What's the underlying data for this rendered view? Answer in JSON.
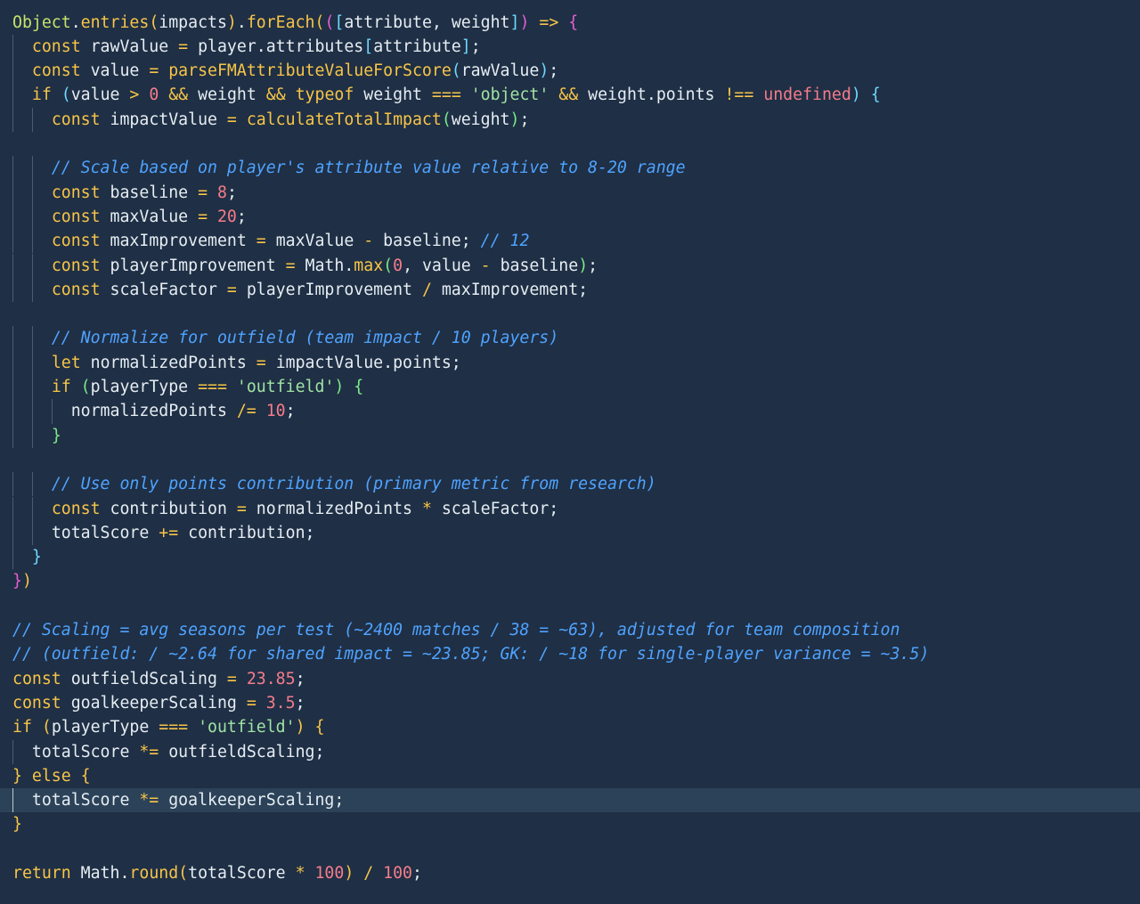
{
  "editor": {
    "language": "javascript",
    "colors": {
      "background": "#1f2f45",
      "current_line": "#2b4258",
      "keyword": "#f7c548",
      "text": "#e6edf3",
      "number": "#f47c8a",
      "string": "#9fe3a4",
      "comment": "#4fa3ff"
    },
    "lines": [
      "Object.entries(impacts).forEach(([attribute, weight]) => {",
      "  const rawValue = player.attributes[attribute];",
      "  const value = parseFMAttributeValueForScore(rawValue);",
      "  if (value > 0 && weight && typeof weight === 'object' && weight.points !== undefined) {",
      "    const impactValue = calculateTotalImpact(weight);",
      "",
      "    // Scale based on player's attribute value relative to 8-20 range",
      "    const baseline = 8;",
      "    const maxValue = 20;",
      "    const maxImprovement = maxValue - baseline; // 12",
      "    const playerImprovement = Math.max(0, value - baseline);",
      "    const scaleFactor = playerImprovement / maxImprovement;",
      "",
      "    // Normalize for outfield (team impact / 10 players)",
      "    let normalizedPoints = impactValue.points;",
      "    if (playerType === 'outfield') {",
      "      normalizedPoints /= 10;",
      "    }",
      "",
      "    // Use only points contribution (primary metric from research)",
      "    const contribution = normalizedPoints * scaleFactor;",
      "    totalScore += contribution;",
      "  }",
      "})",
      "",
      "// Scaling = avg seasons per test (~2400 matches / 38 = ~63), adjusted for team composition",
      "// (outfield: / ~2.64 for shared impact = ~23.85; GK: / ~18 for single-player variance = ~3.5)",
      "const outfieldScaling = 23.85;",
      "const goalkeeperScaling = 3.5;",
      "if (playerType === 'outfield') {",
      "  totalScore *= outfieldScaling;",
      "} else {",
      "  totalScore *= goalkeeperScaling;",
      "}",
      "",
      "return Math.round(totalScore * 100) / 100;"
    ]
  }
}
